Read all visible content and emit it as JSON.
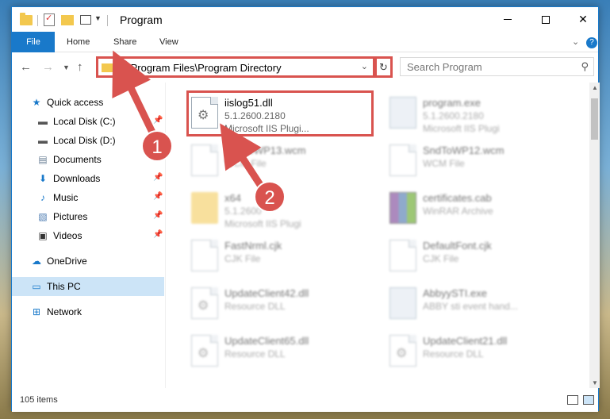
{
  "window": {
    "title": "Program",
    "controls": {
      "minimize": "—",
      "maximize": "☐",
      "close": "✕"
    }
  },
  "ribbon": {
    "tabs": [
      {
        "label": "File"
      },
      {
        "label": "Home"
      },
      {
        "label": "Share"
      },
      {
        "label": "View"
      }
    ],
    "help": "?"
  },
  "address": {
    "path": "C:\\Program Files\\Program Directory",
    "refresh_icon": "↻",
    "search_placeholder": "Search Program"
  },
  "sidebar": {
    "items": [
      {
        "label": "Quick access",
        "icon": "star-icon",
        "pinned": false
      },
      {
        "label": "Local Disk (C:)",
        "icon": "drive-icon",
        "pinned": true
      },
      {
        "label": "Local Disk (D:)",
        "icon": "drive-icon",
        "pinned": false
      },
      {
        "label": "Documents",
        "icon": "documents-icon",
        "pinned": false
      },
      {
        "label": "Downloads",
        "icon": "download-icon",
        "pinned": true
      },
      {
        "label": "Music",
        "icon": "music-icon",
        "pinned": true
      },
      {
        "label": "Pictures",
        "icon": "pictures-icon",
        "pinned": true
      },
      {
        "label": "Videos",
        "icon": "videos-icon",
        "pinned": true
      },
      {
        "label": "OneDrive",
        "icon": "cloud-icon",
        "pinned": false
      },
      {
        "label": "This PC",
        "icon": "computer-icon",
        "pinned": false,
        "selected": true
      },
      {
        "label": "Network",
        "icon": "network-icon",
        "pinned": false
      }
    ]
  },
  "files": [
    {
      "name": "iislog51.dll",
      "meta1": "5.1.2600.2180",
      "meta2": "Microsoft IIS Plugi...",
      "icon": "dll-icon",
      "highlighted": true
    },
    {
      "name": "program.exe",
      "meta1": "5.1.2600.2180",
      "meta2": "Microsoft IIS Plugi",
      "icon": "exe-icon"
    },
    {
      "name": "SndToWP13.wcm",
      "meta1": "WCM File",
      "meta2": "",
      "icon": "document-icon"
    },
    {
      "name": "SndToWP12.wcm",
      "meta1": "WCM File",
      "meta2": "",
      "icon": "document-icon"
    },
    {
      "name": "x64",
      "meta1": "5.1.2600",
      "meta2": "Microsoft IIS Plugi",
      "icon": "folder-icon"
    },
    {
      "name": "certificates.cab",
      "meta1": "WinRAR Archive",
      "meta2": "",
      "icon": "archive-icon"
    },
    {
      "name": "FastNrml.cjk",
      "meta1": "CJK File",
      "meta2": "",
      "icon": "document-icon"
    },
    {
      "name": "DefaultFont.cjk",
      "meta1": "CJK File",
      "meta2": "",
      "icon": "document-icon"
    },
    {
      "name": "UpdateClient42.dll",
      "meta1": "Resource DLL",
      "meta2": "",
      "icon": "dll-icon"
    },
    {
      "name": "AbbyySTI.exe",
      "meta1": "ABBY sti event hand...",
      "meta2": "",
      "icon": "exe-icon"
    },
    {
      "name": "UpdateClient65.dll",
      "meta1": "Resource DLL",
      "meta2": "",
      "icon": "dll-icon"
    },
    {
      "name": "UpdateClient21.dll",
      "meta1": "Resource DLL",
      "meta2": "",
      "icon": "dll-icon"
    }
  ],
  "status": {
    "item_count": "105 items"
  },
  "annotations": [
    {
      "number": "1"
    },
    {
      "number": "2"
    }
  ],
  "colors": {
    "accent": "#1979ca",
    "highlight": "#d9534f",
    "selected_bg": "#cce4f7"
  }
}
